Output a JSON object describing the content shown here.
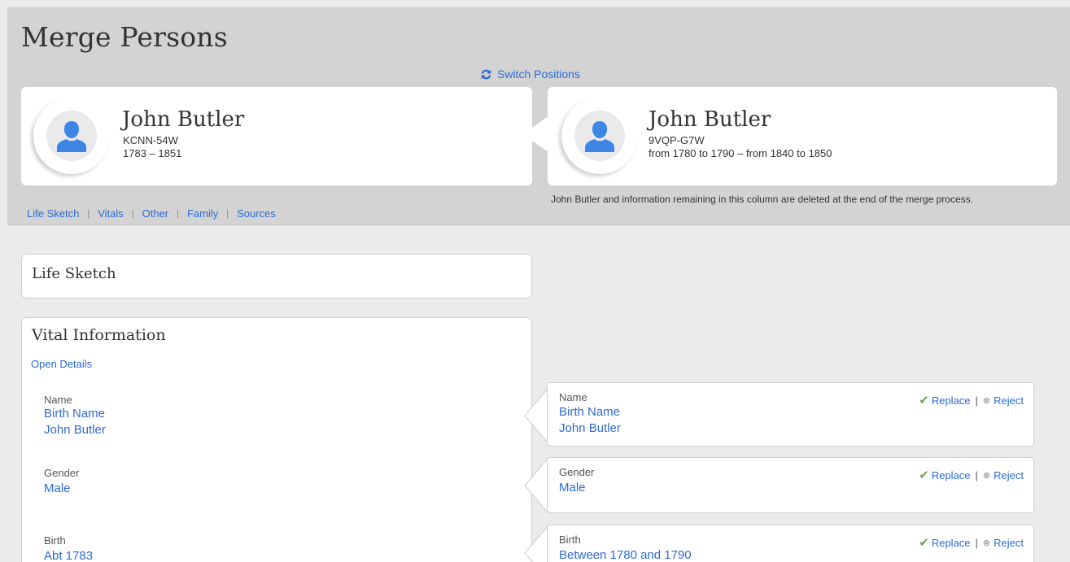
{
  "page": {
    "title": "Merge Persons"
  },
  "switch": {
    "label": "Switch Positions"
  },
  "left_person": {
    "name": "John Butler",
    "id": "KCNN-54W",
    "dates": "1783 – 1851"
  },
  "right_person": {
    "name": "John Butler",
    "id": "9VQP-G7W",
    "dates": "from 1780 to 1790 – from 1840 to 1850"
  },
  "nav": {
    "items": [
      "Life Sketch",
      "Vitals",
      "Other",
      "Family",
      "Sources"
    ]
  },
  "merge_note": "John Butler and information remaining in this column are deleted at the end of the merge process.",
  "life_sketch": {
    "title": "Life Sketch"
  },
  "vital": {
    "title": "Vital Information",
    "open_details": "Open Details",
    "left": {
      "name_label": "Name",
      "name_type": "Birth Name",
      "name_value": "John Butler",
      "gender_label": "Gender",
      "gender_value": "Male",
      "birth_label": "Birth",
      "birth_value": "Abt 1783"
    },
    "right": {
      "name_label": "Name",
      "name_type": "Birth Name",
      "name_value": "John Butler",
      "gender_label": "Gender",
      "gender_value": "Male",
      "birth_label": "Birth",
      "birth_value": "Between 1780 and 1790"
    }
  },
  "actions": {
    "replace": "Replace",
    "reject": "Reject"
  },
  "colors": {
    "link": "#2c6bd1",
    "avatar": "#3d86e5",
    "check": "#6aa84f",
    "band": "#d3d3d3"
  }
}
